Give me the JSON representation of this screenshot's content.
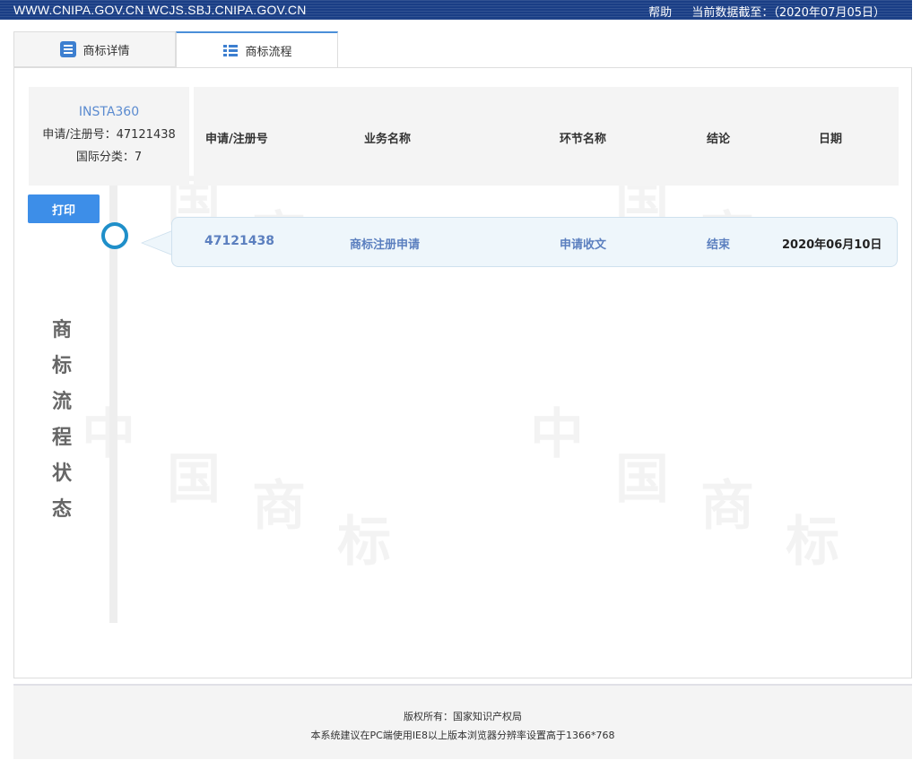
{
  "topbar": {
    "url": "WWW.CNIPA.GOV.CN WCJS.SBJ.CNIPA.GOV.CN",
    "help": "帮助",
    "data_cutoff": "当前数据截至：（2020年07月05日）"
  },
  "tabs": [
    {
      "label": "商标详情",
      "icon": "document-icon"
    },
    {
      "label": "商标流程",
      "icon": "list-icon"
    }
  ],
  "info": {
    "name": "INSTA360",
    "reg_no": "申请/注册号：47121438",
    "class": "国际分类：7"
  },
  "table": {
    "headers": [
      "申请/注册号",
      "业务名称",
      "环节名称",
      "结论",
      "日期"
    ],
    "rows": [
      {
        "reg_no": "47121438",
        "business": "商标注册申请",
        "step": "申请收文",
        "conclusion": "结束",
        "date": "2020年06月10日"
      }
    ]
  },
  "print_label": "打印",
  "vertical_title": [
    "商",
    "标",
    "流",
    "程",
    "状",
    "态"
  ],
  "footer": {
    "line1": "版权所有：国家知识产权局",
    "line2": "本系统建议在PC端使用IE8以上版本浏览器分辨率设置高于1366*768"
  },
  "colors": {
    "topbar": "#1a3e86",
    "accent": "#3d8ee8",
    "link": "#5b7fbf",
    "timeline_circle": "#1f8fc9"
  }
}
